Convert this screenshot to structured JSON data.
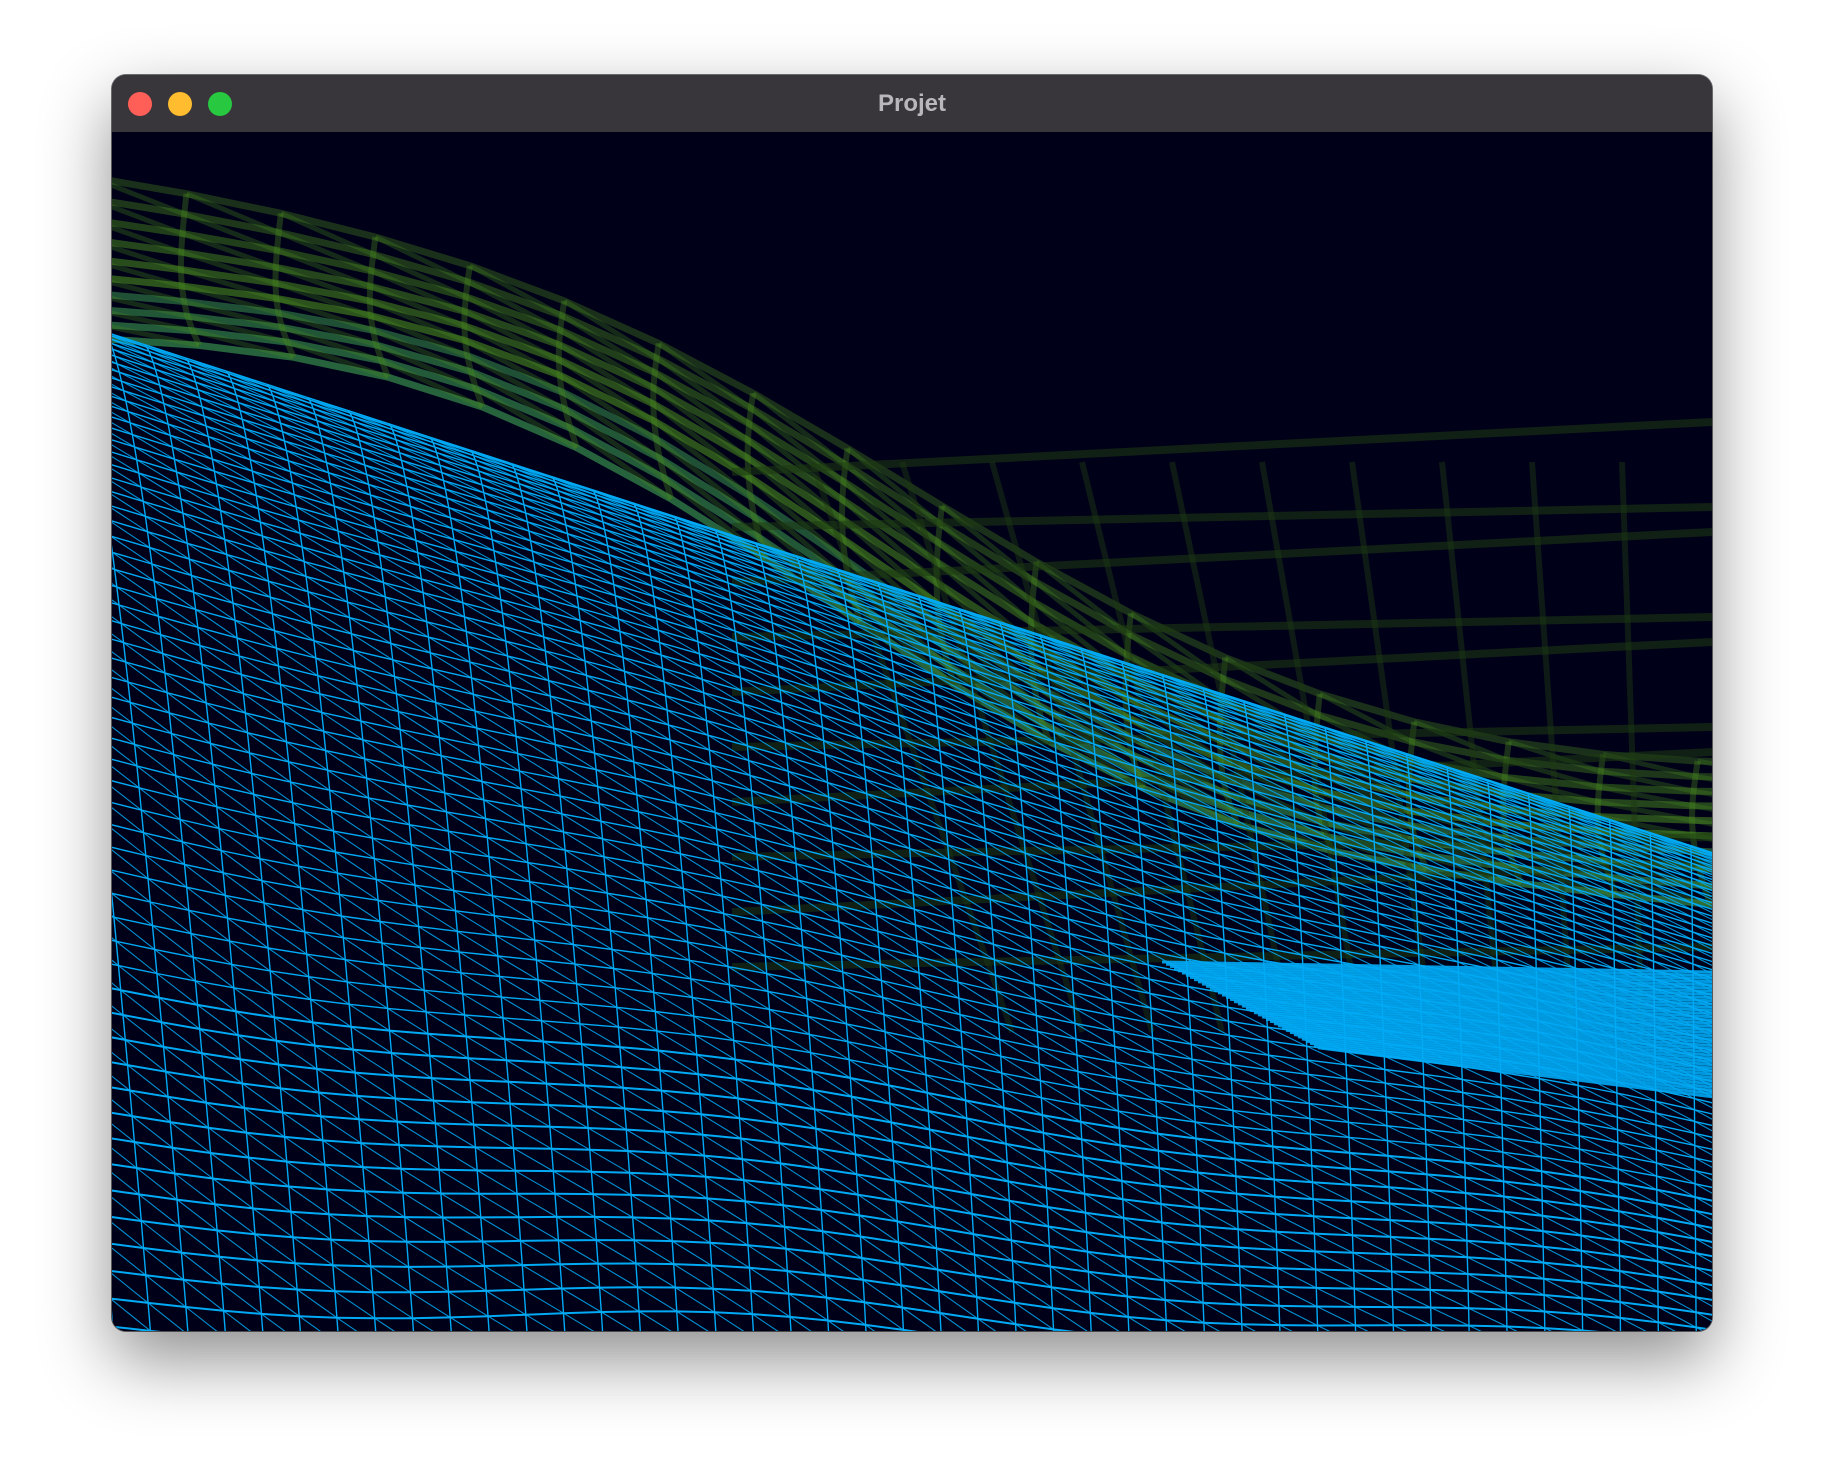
{
  "window": {
    "title": "Projet"
  },
  "traffic_lights": {
    "close_color": "#ff5f57",
    "minimize_color": "#febc2e",
    "zoom_color": "#28c840"
  },
  "scene": {
    "background_color": "#000018",
    "back_mesh_color": "#4a8a20",
    "front_mesh_color": "#00aaf5"
  }
}
